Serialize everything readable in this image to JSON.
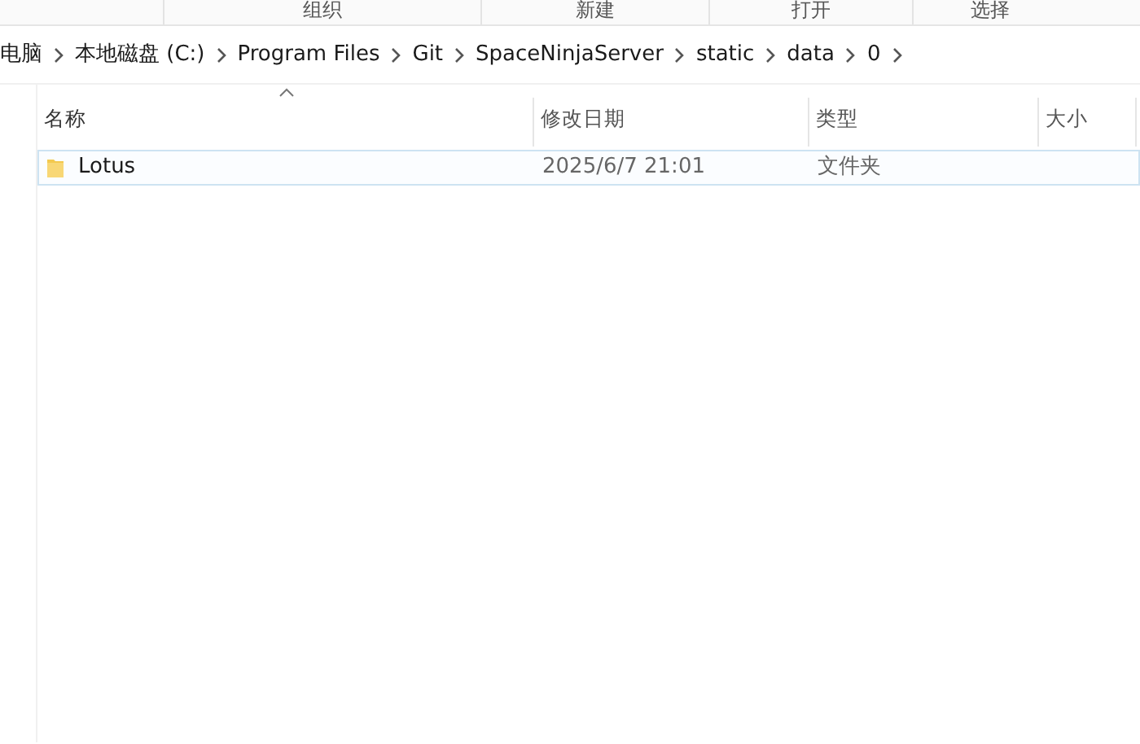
{
  "ribbon": {
    "groups": [
      "组织",
      "新建",
      "打开",
      "选择"
    ]
  },
  "breadcrumb": [
    "电脑",
    "本地磁盘 (C:)",
    "Program Files",
    "Git",
    "SpaceNinjaServer",
    "static",
    "data",
    "0"
  ],
  "table": {
    "columns": [
      {
        "label": "名称",
        "sorted": true
      },
      {
        "label": "修改日期",
        "sorted": false
      },
      {
        "label": "类型",
        "sorted": false
      },
      {
        "label": "大小",
        "sorted": false
      }
    ],
    "rows": [
      {
        "name": "Lotus",
        "modified": "2025/6/7 21:01",
        "type": "文件夹",
        "hovered": true
      }
    ]
  }
}
